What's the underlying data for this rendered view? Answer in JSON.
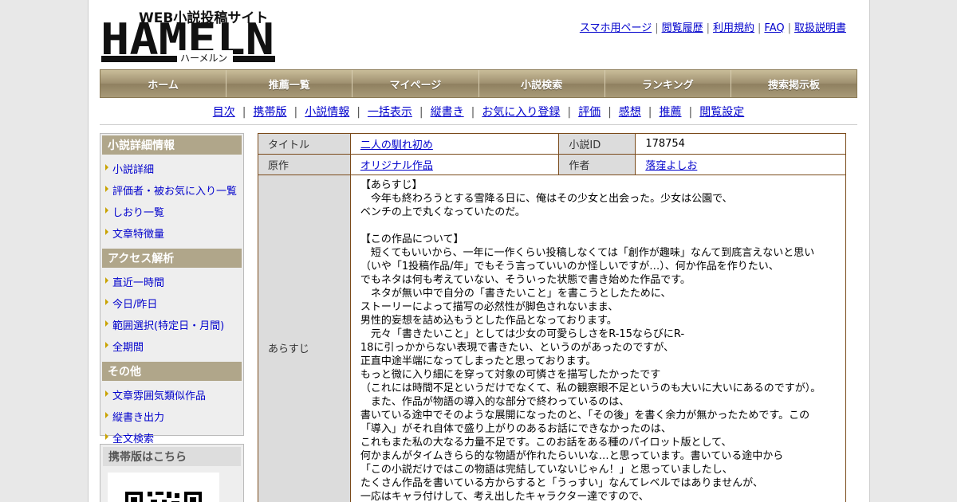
{
  "header": {
    "logo_title": "HAMELN",
    "logo_tagline": "WEB小説投稿サイト",
    "logo_kana": "ハーメルン",
    "toplinks": [
      "スマホ用ページ",
      "閲覧履歴",
      "利用規約",
      "FAQ",
      "取扱説明書"
    ]
  },
  "global_nav": [
    "ホーム",
    "推薦一覧",
    "マイページ",
    "小説検索",
    "ランキング",
    "捜索掲示板"
  ],
  "sub_nav": [
    "目次",
    "携帯版",
    "小説情報",
    "一括表示",
    "縦書き",
    "お気に入り登録",
    "評価",
    "感想",
    "推薦",
    "閲覧設定"
  ],
  "sidebar": {
    "sections": [
      {
        "title": "小説詳細情報",
        "items": [
          "小説詳細",
          "評価者・被お気に入り一覧",
          "しおり一覧",
          "文章特徴量"
        ]
      },
      {
        "title": "アクセス解析",
        "items": [
          "直近一時間",
          "今日/昨日",
          "範囲選択(特定日・月間)",
          "全期間"
        ]
      },
      {
        "title": "その他",
        "items": [
          "文章雰囲気類似作品",
          "縦書き出力",
          "全文検索"
        ]
      }
    ],
    "mobile_title": "携帯版はこちら"
  },
  "info": {
    "title_label": "タイトル",
    "title_value": "二人の馴れ初め",
    "id_label": "小説ID",
    "id_value": "178754",
    "origin_label": "原作",
    "origin_value": "オリジナル作品",
    "author_label": "作者",
    "author_value": "落窪よしお",
    "synopsis_label": "あらすじ",
    "synopsis_text": "【あらすじ】\n　今年も終わろうとする雪降る日に、俺はその少女と出会った。少女は公園で、\nベンチの上で丸くなっていたのだ。\n\n【この作品について】\n　短くてもいいから、一年に一作くらい投稿しなくては「創作が趣味」なんて到底言えないと思い\n（いや「1投稿作品/年」でもそう言っていいのか怪しいですが…）、何か作品を作りたい、\nでもネタは何も考えていない、そういった状態で書き始めた作品です。\n　ネタが無い中で自分の「書きたいこと」を書こうとしたために、\nストーリーによって描写の必然性が脚色されないまま、\n男性的妄想を詰め込もうとした作品となっております。\n　元々「書きたいこと」としては少女の可愛らしさをR-15ならびにR-\n18に引っかからない表現で書きたい、というのがあったのですが、\n正直中途半端になってしまったと思っております。\nもっと微に入り細にを穿って対象の可憐さを描写したかったです\n（これには時間不足というだけでなくて、私の観察眼不足というのも大いに大いにあるのですが）。\n　また、作品が物語の導入的な部分で終わっているのは、\n書いている途中でそのような展開になったのと、「その後」を書く余力が無かったためです。この\n「導入」がそれ自体で盛り上がりのあるお話にできなかったのは、\nこれもまた私の大なる力量不足です。このお話をある種のパイロット版として、\n何かまんがタイムきらら的な物語が作れたらいいな…と思っています。書いている途中から\n「この小説だけではこの物語は完結していないじゃん！」と思っていましたし、\nたくさん作品を書いている方からすると「うっすい」なんてレベルではありませんが、\n一応はキャラ付けして、考え出したキャラクター達ですので、\n彼らが活躍する物語が書けたらいいなと思うのです。"
  }
}
